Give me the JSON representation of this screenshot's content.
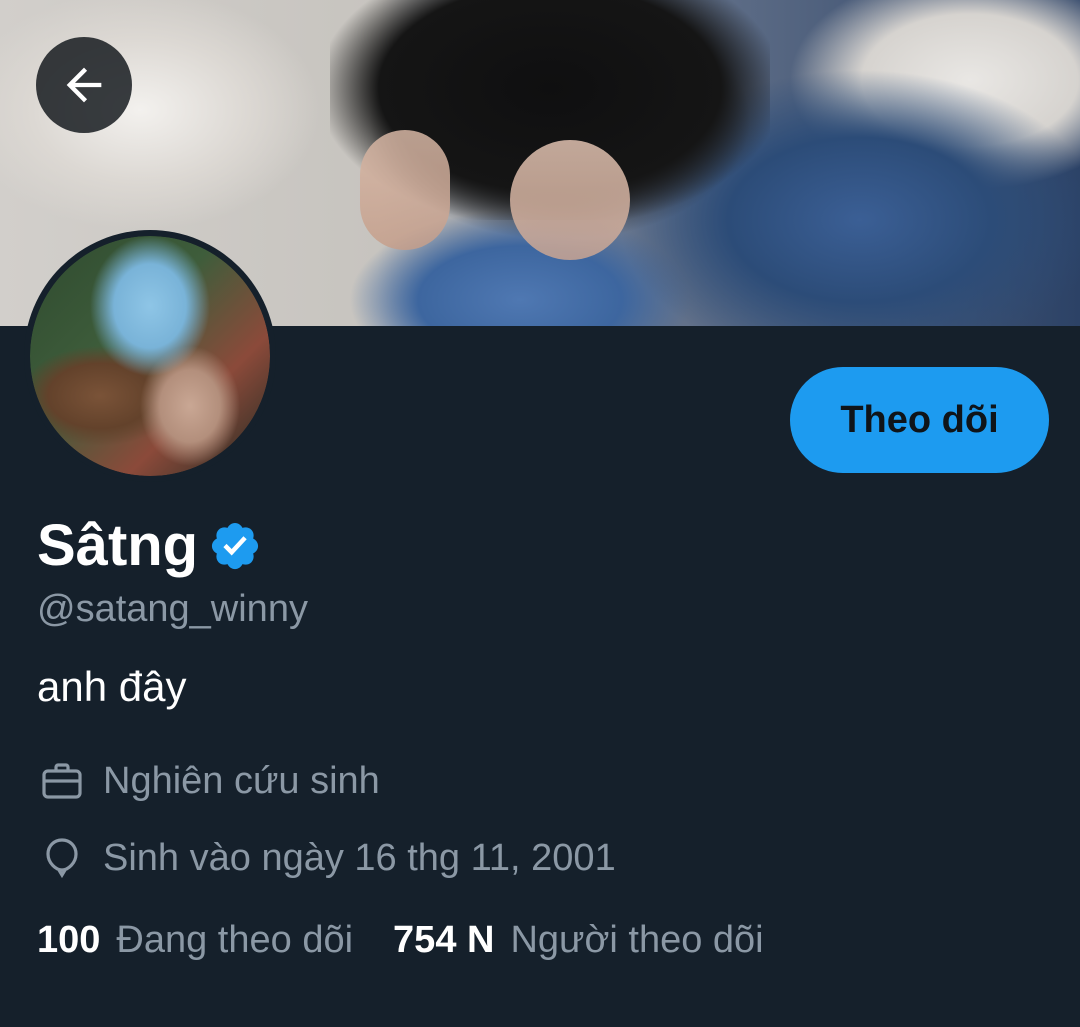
{
  "profile": {
    "display_name": "Sâtng",
    "handle": "@satang_winny",
    "bio": "anh đây",
    "job": "Nghiên cứu sinh",
    "birthday": "Sinh vào ngày 16 thg 11, 2001",
    "following_count": "100",
    "following_label": "Đang theo dõi",
    "followers_count": "754 N",
    "followers_label": "Người theo dõi"
  },
  "actions": {
    "follow_label": "Theo dõi"
  },
  "icons": {
    "back": "arrow-left-icon",
    "verified": "verified-badge-icon",
    "job": "briefcase-icon",
    "birthday": "balloon-icon"
  },
  "colors": {
    "background": "#15202b",
    "accent": "#1d9bf0",
    "secondary_text": "#8b98a5",
    "primary_text": "#ffffff"
  }
}
